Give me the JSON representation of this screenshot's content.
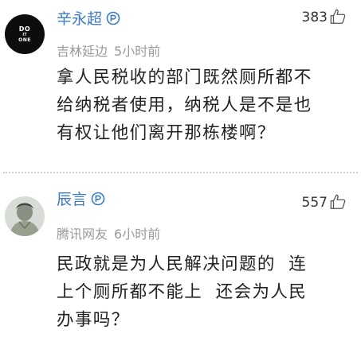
{
  "comments": [
    {
      "username": "辛永超",
      "location": "吉林延边",
      "time": "5小时前",
      "likes": "383",
      "text": "拿人民税收的部门既然厕所都不\n给纳税者使用，纳税人是不是也\n有权让他们离开那栋楼啊？",
      "avatar_marks": [
        "DO",
        "IT",
        "ONE"
      ]
    },
    {
      "username": "辰言",
      "location": "腾讯网友",
      "time": "6小时前",
      "likes": "557",
      "text": "民政就是为人民解决问题的  连\n上个厕所都不能上  还会为人民\n办事吗？"
    }
  ],
  "colors": {
    "username": "#3d7bc4",
    "meta": "#9a9a9a",
    "body": "#222222",
    "divider": "#cfcfcf"
  },
  "icons": {
    "verified": "verified-badge-icon",
    "like": "thumbs-up-icon"
  }
}
